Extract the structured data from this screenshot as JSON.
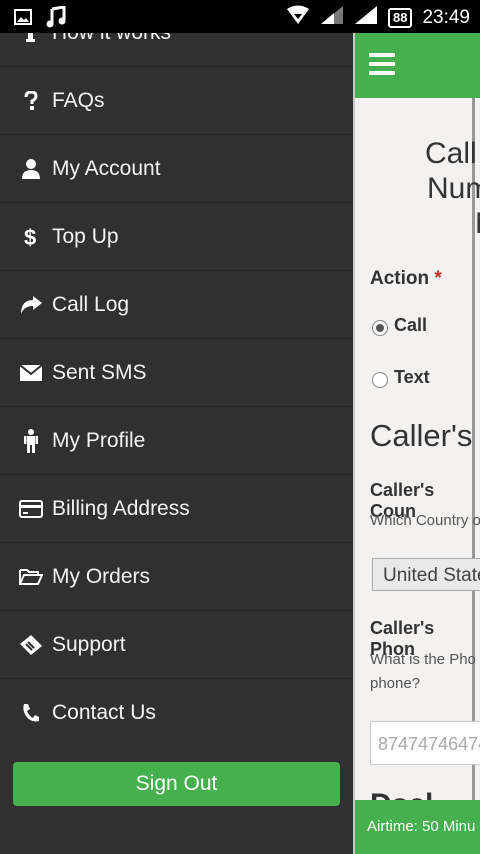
{
  "status_bar": {
    "battery": "88",
    "time": "23:49"
  },
  "drawer": {
    "partial_item": "How it works",
    "items": [
      {
        "label": "FAQs",
        "icon": "question-icon"
      },
      {
        "label": "My Account",
        "icon": "user-icon"
      },
      {
        "label": "Top Up",
        "icon": "dollar-icon"
      },
      {
        "label": "Call Log",
        "icon": "share-icon"
      },
      {
        "label": "Sent SMS",
        "icon": "envelope-icon"
      },
      {
        "label": "My Profile",
        "icon": "person-icon"
      },
      {
        "label": "Billing Address",
        "icon": "credit-card-icon"
      },
      {
        "label": "My Orders",
        "icon": "folder-open-icon"
      },
      {
        "label": "Support",
        "icon": "ticket-icon"
      },
      {
        "label": "Contact Us",
        "icon": "phone-icon"
      }
    ],
    "sign_out": "Sign Out"
  },
  "main": {
    "title_lines": [
      "Call",
      "Num",
      "N"
    ],
    "action_label": "Action",
    "required_mark": "*",
    "options": [
      "Call",
      "Text"
    ],
    "section_title": "Caller's",
    "country_label": "Caller's Coun",
    "country_help": "Which Country o",
    "country_value": "United State",
    "phone_label": "Caller's Phon",
    "phone_help_1": "What is the Pho",
    "phone_help_2": "phone?",
    "phone_placeholder": "87474746474",
    "peek_heading": "Dscl",
    "airtime": "Airtime: 50 Minu"
  },
  "colors": {
    "brand_green": "#45b04d",
    "drawer_bg": "#303030"
  }
}
